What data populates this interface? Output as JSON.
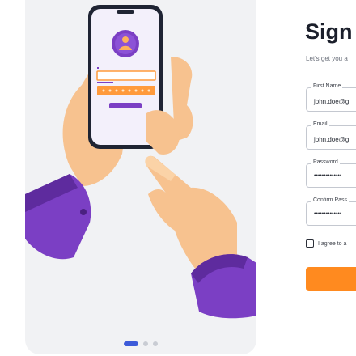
{
  "form": {
    "title": "Sign u",
    "subtitle": "Let's get you a",
    "fields": [
      {
        "label": "First Name",
        "value": "john.doe@g"
      },
      {
        "label": "Email",
        "value": "john.doe@g"
      },
      {
        "label": "Password",
        "value": "••••••••••••••"
      },
      {
        "label": "Confirm Pass",
        "value": "••••••••••••••"
      }
    ],
    "agree_text": "I agree to a"
  },
  "phone": {
    "login_label": "Login",
    "password_label": "Password"
  },
  "colors": {
    "accent": "#ff8a1f",
    "purple": "#7b3fc4",
    "carousel_active": "#3d5bd9"
  },
  "carousel": {
    "count": 3,
    "active_index": 0
  }
}
